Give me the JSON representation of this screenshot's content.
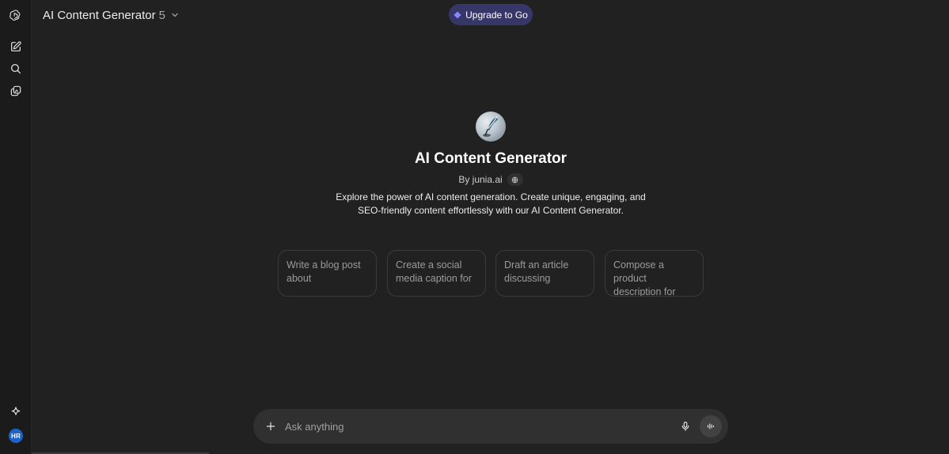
{
  "header": {
    "model_name": "AI Content Generator",
    "model_version": "5",
    "upgrade_label": "Upgrade to Go"
  },
  "sidebar": {
    "items": [
      {
        "icon": "openai-logo-icon"
      },
      {
        "icon": "new-chat-icon"
      },
      {
        "icon": "search-icon"
      },
      {
        "icon": "library-icon"
      }
    ],
    "bottom": [
      {
        "icon": "sparkle-icon"
      }
    ],
    "avatar_initials": "HR"
  },
  "gpt": {
    "title": "AI Content Generator",
    "byline": "By junia.ai",
    "description": "Explore the power of AI content generation. Create unique, engaging, and SEO-friendly content effortlessly with our AI Content Generator.",
    "starters": [
      {
        "text": "Write a blog post about"
      },
      {
        "text": "Create a social media caption for"
      },
      {
        "text": "Draft an article discussing"
      },
      {
        "text": "Compose a product description for"
      }
    ]
  },
  "composer": {
    "placeholder": "Ask anything",
    "value": ""
  },
  "colors": {
    "background": "#212121",
    "rail": "#1b1b1b",
    "upgrade": "#373669",
    "upgrade_icon": "#8b86ff",
    "avatar": "#1c64c8",
    "composer": "#303030"
  }
}
